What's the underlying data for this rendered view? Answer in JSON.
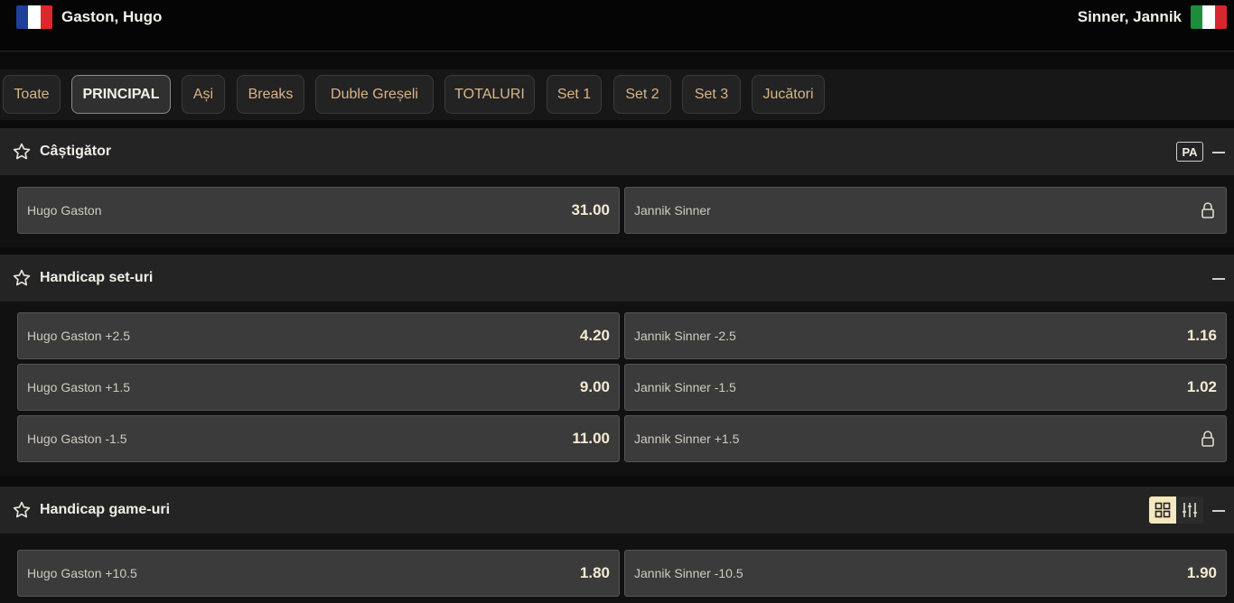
{
  "teams": {
    "home": {
      "name": "Gaston, Hugo",
      "flag_colors": [
        "#1f3f99",
        "#ffffff",
        "#e1262b"
      ]
    },
    "away": {
      "name": "Sinner, Jannik",
      "flag_colors": [
        "#1c8c3d",
        "#ffffff",
        "#d7262d"
      ]
    }
  },
  "tabs": [
    {
      "label": "Toate",
      "active": false
    },
    {
      "label": "PRINCIPAL",
      "active": true
    },
    {
      "label": "Ași",
      "active": false
    },
    {
      "label": "Breaks",
      "active": false
    },
    {
      "label": "Duble Greșeli",
      "active": false
    },
    {
      "label": "TOTALURI",
      "active": false
    },
    {
      "label": "Set 1",
      "active": false
    },
    {
      "label": "Set 2",
      "active": false
    },
    {
      "label": "Set 3",
      "active": false
    },
    {
      "label": "Jucători",
      "active": false
    }
  ],
  "markets": {
    "winner": {
      "title": "Câștigător",
      "badge": "PA",
      "rows": [
        {
          "left": {
            "label": "Hugo Gaston",
            "price": "31.00"
          },
          "right": {
            "label": "Jannik Sinner",
            "locked": true
          }
        }
      ]
    },
    "set_handicap": {
      "title": "Handicap set-uri",
      "rows": [
        {
          "left": {
            "label": "Hugo Gaston +2.5",
            "price": "4.20"
          },
          "right": {
            "label": "Jannik Sinner -2.5",
            "price": "1.16"
          }
        },
        {
          "left": {
            "label": "Hugo Gaston +1.5",
            "price": "9.00"
          },
          "right": {
            "label": "Jannik Sinner -1.5",
            "price": "1.02"
          }
        },
        {
          "left": {
            "label": "Hugo Gaston -1.5",
            "price": "11.00"
          },
          "right": {
            "label": "Jannik Sinner +1.5",
            "locked": true
          }
        }
      ]
    },
    "game_handicap": {
      "title": "Handicap game-uri",
      "view_icons": [
        "grid-view-icon",
        "sliders-icon"
      ],
      "rows": [
        {
          "left": {
            "label": "Hugo Gaston +10.5",
            "price": "1.80"
          },
          "right": {
            "label": "Jannik Sinner -10.5",
            "price": "1.90"
          }
        }
      ]
    }
  },
  "colors": {
    "accent": "#d7b58a",
    "price": "#f6ead0",
    "panel": "#242424",
    "button": "#3a3b3a"
  }
}
